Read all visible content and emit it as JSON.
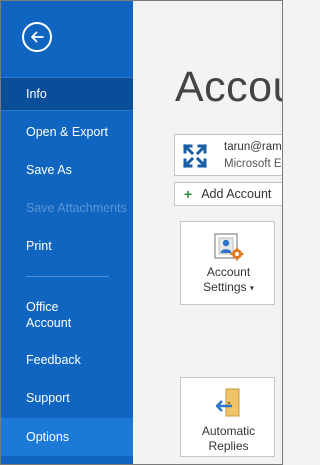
{
  "nav": {
    "items": [
      {
        "label": "Info"
      },
      {
        "label": "Open & Export"
      },
      {
        "label": "Save As"
      },
      {
        "label": "Save Attachments"
      },
      {
        "label": "Print"
      },
      {
        "label": "Office",
        "label2": "Account"
      },
      {
        "label": "Feedback"
      },
      {
        "label": "Support"
      },
      {
        "label": "Options"
      }
    ]
  },
  "main": {
    "title": "Account",
    "account": {
      "email": "tarun@ram",
      "type": "Microsoft E"
    },
    "add_account_label": "Add Account",
    "tiles": {
      "settings": {
        "line1": "Account",
        "line2": "Settings"
      },
      "replies": {
        "line1": "Automatic",
        "line2": "Replies"
      }
    }
  },
  "colors": {
    "nav_bg": "#0f65c0",
    "nav_selected": "#0a4d99",
    "nav_hover": "#1c7ad6",
    "content_bg": "#f3f3f3"
  }
}
